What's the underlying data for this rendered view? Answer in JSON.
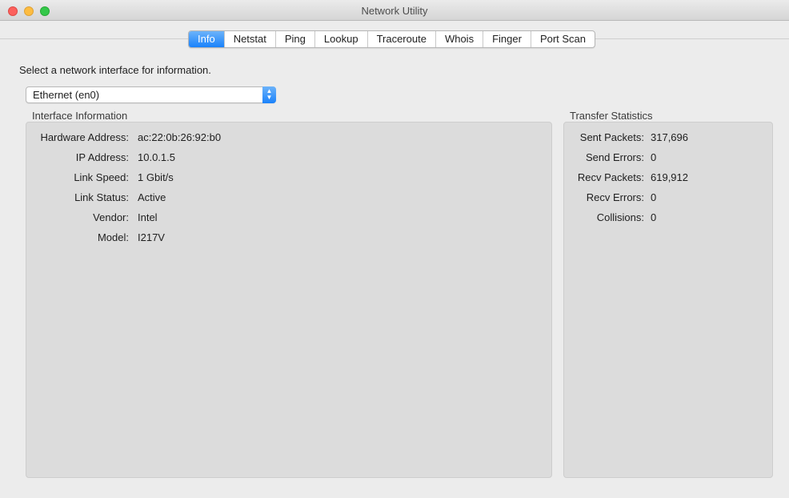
{
  "window": {
    "title": "Network Utility"
  },
  "tabs": [
    {
      "label": "Info",
      "active": true
    },
    {
      "label": "Netstat",
      "active": false
    },
    {
      "label": "Ping",
      "active": false
    },
    {
      "label": "Lookup",
      "active": false
    },
    {
      "label": "Traceroute",
      "active": false
    },
    {
      "label": "Whois",
      "active": false
    },
    {
      "label": "Finger",
      "active": false
    },
    {
      "label": "Port Scan",
      "active": false
    }
  ],
  "prompt": "Select a network interface for information.",
  "interface_select": {
    "value": "Ethernet (en0)"
  },
  "interface_info": {
    "title": "Interface Information",
    "rows": [
      {
        "key": "Hardware Address:",
        "value": "ac:22:0b:26:92:b0"
      },
      {
        "key": "IP Address:",
        "value": "10.0.1.5"
      },
      {
        "key": "Link Speed:",
        "value": "1 Gbit/s"
      },
      {
        "key": "Link Status:",
        "value": "Active"
      },
      {
        "key": "Vendor:",
        "value": "Intel"
      },
      {
        "key": "Model:",
        "value": "I217V"
      }
    ]
  },
  "transfer_stats": {
    "title": "Transfer Statistics",
    "rows": [
      {
        "key": "Sent Packets:",
        "value": "317,696"
      },
      {
        "key": "Send Errors:",
        "value": "0"
      },
      {
        "key": "Recv Packets:",
        "value": "619,912"
      },
      {
        "key": "Recv Errors:",
        "value": "0"
      },
      {
        "key": "Collisions:",
        "value": "0"
      }
    ]
  },
  "colors": {
    "accent": "#1a82fb",
    "window_bg": "#ececec",
    "group_bg": "#dcdcdc"
  }
}
